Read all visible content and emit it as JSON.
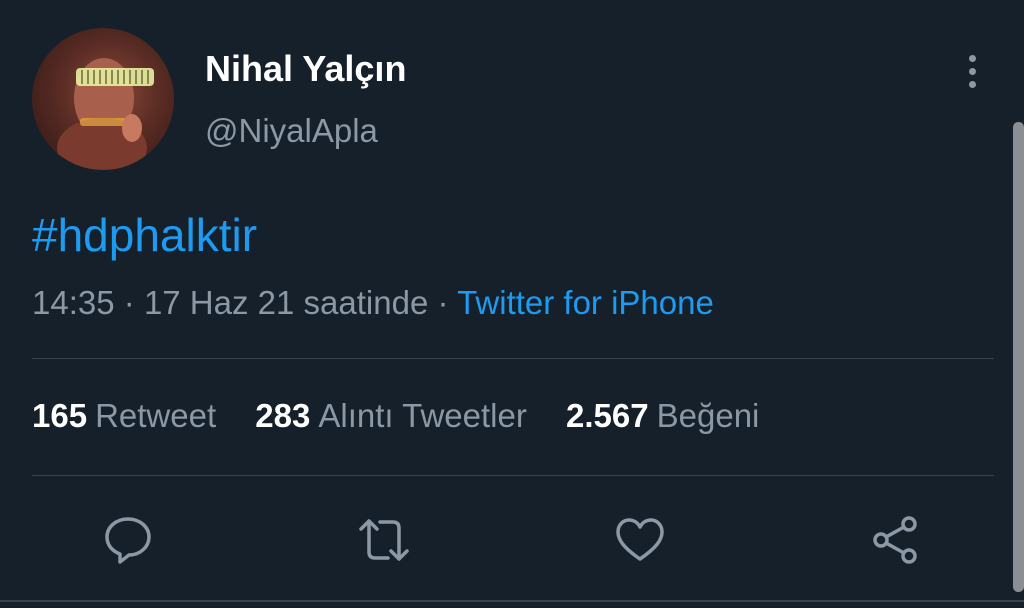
{
  "author": {
    "display_name": "Nihal Yalçın",
    "handle": "@NiyalApla"
  },
  "tweet": {
    "hashtag": "#hdphalktir",
    "time": "14:35",
    "date": "17 Haz 21 saatinde",
    "separator": "·",
    "source": "Twitter for iPhone"
  },
  "stats": {
    "retweets": {
      "count": "165",
      "label": "Retweet"
    },
    "quotes": {
      "count": "283",
      "label": "Alıntı Tweetler"
    },
    "likes": {
      "count": "2.567",
      "label": "Beğeni"
    }
  },
  "actions": [
    "reply-icon",
    "retweet-icon",
    "like-icon",
    "share-icon"
  ],
  "colors": {
    "background": "#15202b",
    "accent": "#1d9bf0",
    "secondary_text": "#8b98a5",
    "divider": "#38444d"
  }
}
